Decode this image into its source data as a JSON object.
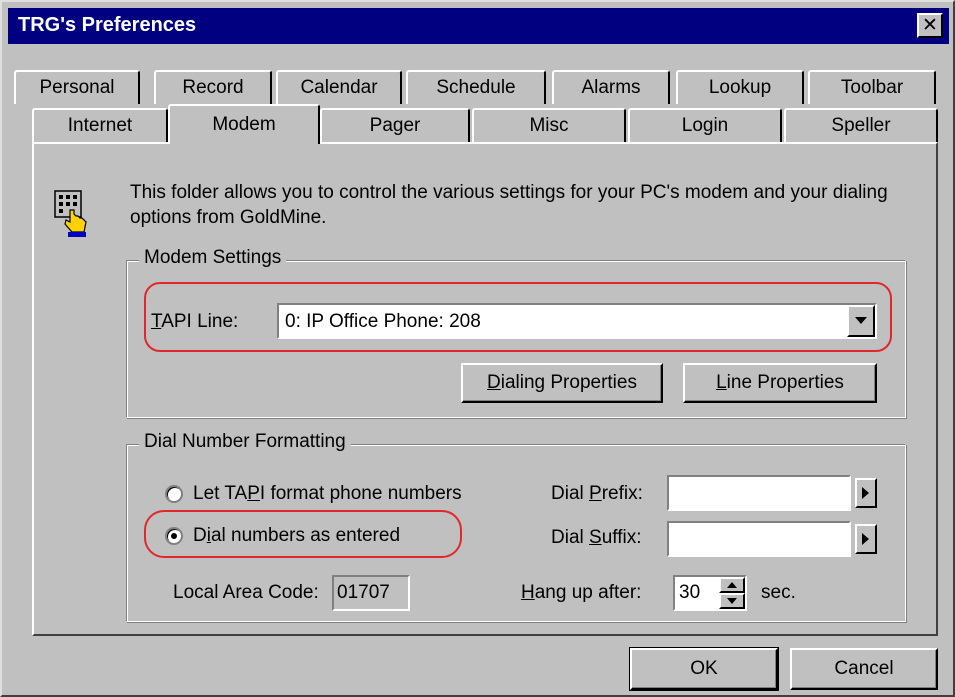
{
  "window": {
    "title": "TRG's Preferences",
    "close_glyph": "✕"
  },
  "tabs_back": [
    "Personal",
    "Record",
    "Calendar",
    "Schedule",
    "Alarms",
    "Lookup",
    "Toolbar"
  ],
  "tabs_front": [
    "Internet",
    "Modem",
    "Pager",
    "Misc",
    "Login",
    "Speller"
  ],
  "active_tab": "Modem",
  "info": {
    "icon": "phone-keypad-hand-icon",
    "text": "This folder allows you to control the various settings for your PC's modem and your dialing options from GoldMine."
  },
  "modem_settings": {
    "legend": "Modem Settings",
    "tapi_label_u": "T",
    "tapi_label_rest": "API Line:",
    "tapi_value": "0: IP Office Phone: 208",
    "dialing_properties_u": "D",
    "dialing_properties_rest": "ialing Properties",
    "line_properties_u": "L",
    "line_properties_rest": "ine Properties"
  },
  "dial_formatting": {
    "legend": "Dial Number Formatting",
    "radio1_pre": "Let TA",
    "radio1_u": "P",
    "radio1_post": "I format phone numbers",
    "radio2_pre": "D",
    "radio2_u": "i",
    "radio2_post": "al numbers as entered",
    "selected": "Dial numbers as entered",
    "local_area_label": "Local Area Code:",
    "local_area_value": "01707",
    "dial_prefix_pre": "Dial ",
    "dial_prefix_u": "P",
    "dial_prefix_post": "refix:",
    "dial_prefix_value": "",
    "dial_suffix_pre": "Dial ",
    "dial_suffix_u": "S",
    "dial_suffix_post": "uffix:",
    "dial_suffix_value": "",
    "hangup_u": "H",
    "hangup_rest": "ang up after:",
    "hangup_value": "30",
    "hangup_unit": "sec."
  },
  "buttons": {
    "ok": "OK",
    "cancel": "Cancel"
  },
  "colors": {
    "titlebar": "#000080",
    "face": "#c0c0c0",
    "highlight_outline": "#e0282c"
  }
}
